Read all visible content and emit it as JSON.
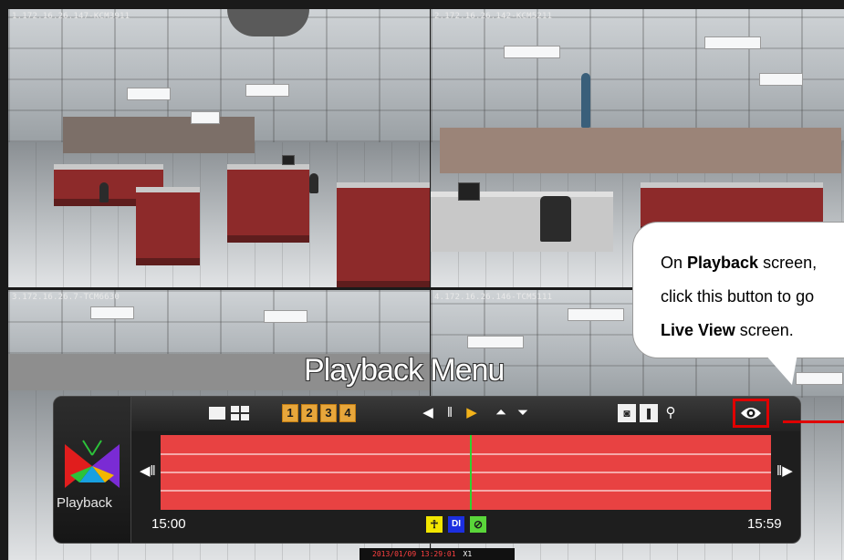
{
  "cameras": [
    {
      "label": "1.172.16.26.147-KCM3911"
    },
    {
      "label": "2.172.16.26.142-KCM5211"
    },
    {
      "label": "3.172.16.26.7-TCM6630"
    },
    {
      "label": "4.172.16.26.146-TCM5111"
    }
  ],
  "title": "Playback Menu",
  "callout": {
    "line1_pre": "On ",
    "line1_bold": "Playback",
    "line1_post": " screen,",
    "line2": "click this button to go",
    "line3_bold": "Live View",
    "line3_post": " screen."
  },
  "panel": {
    "app_label": "Playback",
    "channel_buttons": [
      "1",
      "2",
      "3",
      "4"
    ],
    "time_start": "15:00",
    "time_end": "15:59",
    "event_di_label": "DI"
  },
  "status_bar": {
    "datetime": "2013/01/09 13:29:01",
    "speed": "X1"
  },
  "colors": {
    "timeline": "#e84242",
    "cursor": "#2fd22f",
    "highlight": "#e00000",
    "channel_button": "#e7a63b",
    "event_motion": "#f2e600",
    "event_di": "#1c2fe0",
    "event_vloss": "#5ad63a"
  }
}
